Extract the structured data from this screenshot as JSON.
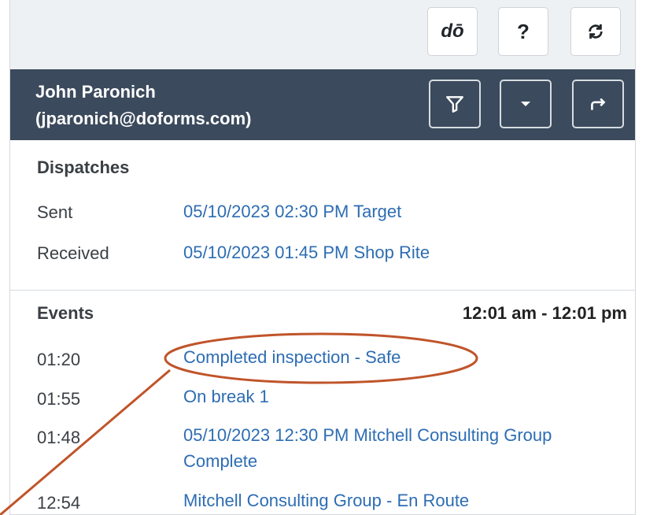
{
  "toolbar": {
    "buttons": [
      {
        "label": "doForms",
        "icon": "doforms-logo-icon"
      },
      {
        "label": "?",
        "icon": "help-icon"
      },
      {
        "label": "refresh",
        "icon": "refresh-icon"
      }
    ]
  },
  "user": {
    "name": "John Paronich",
    "email": "(jparonich@doforms.com)"
  },
  "header_buttons": [
    {
      "icon": "filter-icon"
    },
    {
      "icon": "dropdown-icon"
    },
    {
      "icon": "share-arrow-icon"
    }
  ],
  "dispatches": {
    "title": "Dispatches",
    "rows": [
      {
        "label": "Sent",
        "value": "05/10/2023 02:30 PM Target"
      },
      {
        "label": "Received",
        "value": "05/10/2023 01:45 PM Shop Rite"
      }
    ]
  },
  "events": {
    "title": "Events",
    "time_range": "12:01 am - 12:01 pm",
    "rows": [
      {
        "time": "01:20",
        "text": "Completed inspection - Safe"
      },
      {
        "time": "01:55",
        "text": "On break 1"
      },
      {
        "time": "01:48",
        "text": "05/10/2023 12:30 PM Mitchell Consulting Group Complete"
      },
      {
        "time": "12:54",
        "text": "Mitchell Consulting Group - En Route"
      }
    ]
  },
  "colors": {
    "header_bg": "#3b4a5c",
    "link": "#2d6db3",
    "annotation": "#c0542a"
  }
}
